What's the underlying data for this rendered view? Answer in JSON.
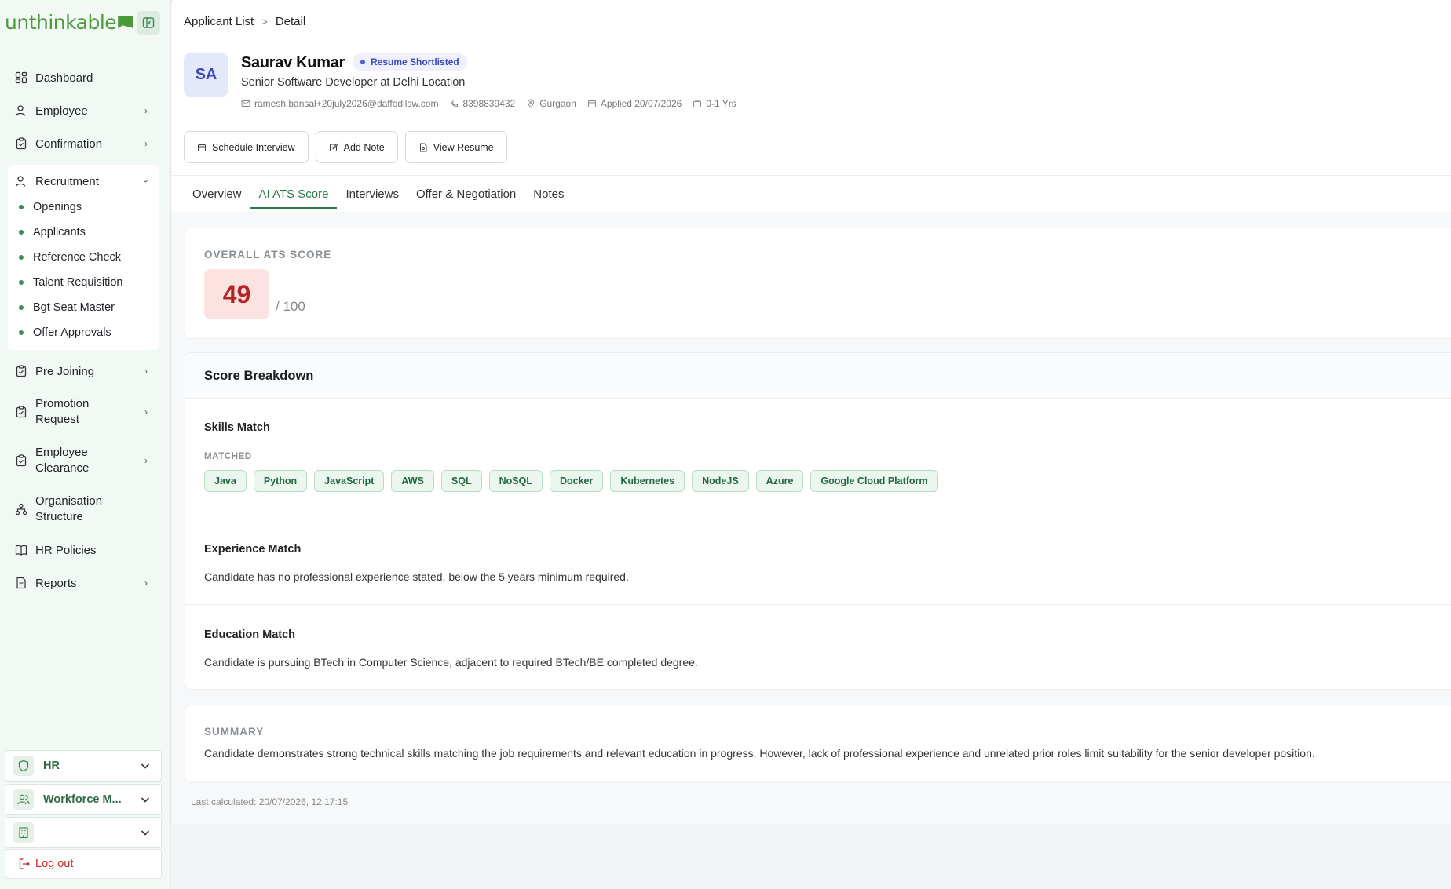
{
  "brand": {
    "name": "unthinkable"
  },
  "sidebar": {
    "items": [
      {
        "label": "Dashboard",
        "icon": "dashboard-icon"
      },
      {
        "label": "Employee",
        "icon": "user-icon"
      },
      {
        "label": "Confirmation",
        "icon": "clipboard-icon"
      },
      {
        "label": "Recruitment",
        "icon": "user-icon"
      },
      {
        "label": "Pre Joining",
        "icon": "clipboard-icon"
      },
      {
        "label": "Promotion Request",
        "icon": "clipboard-icon"
      },
      {
        "label": "Employee Clearance",
        "icon": "clipboard-icon"
      },
      {
        "label": "Organisation Structure",
        "icon": "org-icon"
      },
      {
        "label": "HR Policies",
        "icon": "book-icon"
      },
      {
        "label": "Reports",
        "icon": "report-icon"
      }
    ],
    "recruitment_sub": [
      "Openings",
      "Applicants",
      "Reference Check",
      "Talent Requisition",
      "Bgt Seat Master",
      "Offer Approvals"
    ],
    "bottom": {
      "hr_label": "HR",
      "workforce_label": "Workforce M...",
      "org_label": "",
      "logout_label": "Log out"
    }
  },
  "breadcrumb": {
    "parent": "Applicant List",
    "current": "Detail"
  },
  "applicant": {
    "initials": "SA",
    "name": "Saurav Kumar",
    "status": "Resume Shortlisted",
    "role": "Senior Software Developer at Delhi Location",
    "email": "ramesh.bansal+20july2026@daffodilsw.com",
    "phone": "8398839432",
    "location": "Gurgaon",
    "applied": "Applied 20/07/2026",
    "experience": "0-1 Yrs"
  },
  "actions": {
    "schedule": "Schedule Interview",
    "note": "Add Note",
    "resume": "View Resume"
  },
  "tabs": [
    "Overview",
    "AI ATS Score",
    "Interviews",
    "Offer & Negotiation",
    "Notes"
  ],
  "ats": {
    "label": "OVERALL ATS SCORE",
    "score": "49",
    "max": "/ 100"
  },
  "breakdown": {
    "title": "Score Breakdown",
    "skills": {
      "title": "Skills Match",
      "matched_label": "MATCHED",
      "matched": [
        "Java",
        "Python",
        "JavaScript",
        "AWS",
        "SQL",
        "NoSQL",
        "Docker",
        "Kubernetes",
        "NodeJS",
        "Azure",
        "Google Cloud Platform"
      ]
    },
    "experience": {
      "title": "Experience Match",
      "text": "Candidate has no professional experience stated, below the 5 years minimum required."
    },
    "education": {
      "title": "Education Match",
      "text": "Candidate is pursuing BTech in Computer Science, adjacent to required BTech/BE completed degree."
    }
  },
  "summary": {
    "label": "SUMMARY",
    "text": "Candidate demonstrates strong technical skills matching the job requirements and relevant education in progress. However, lack of professional experience and unrelated prior roles limit suitability for the senior developer position."
  },
  "last_calculated": "Last calculated: 20/07/2026, 12:17:15",
  "colors": {
    "accent": "#2b7a48",
    "score_bad": "#b52424",
    "status": "#3a4bc0"
  }
}
